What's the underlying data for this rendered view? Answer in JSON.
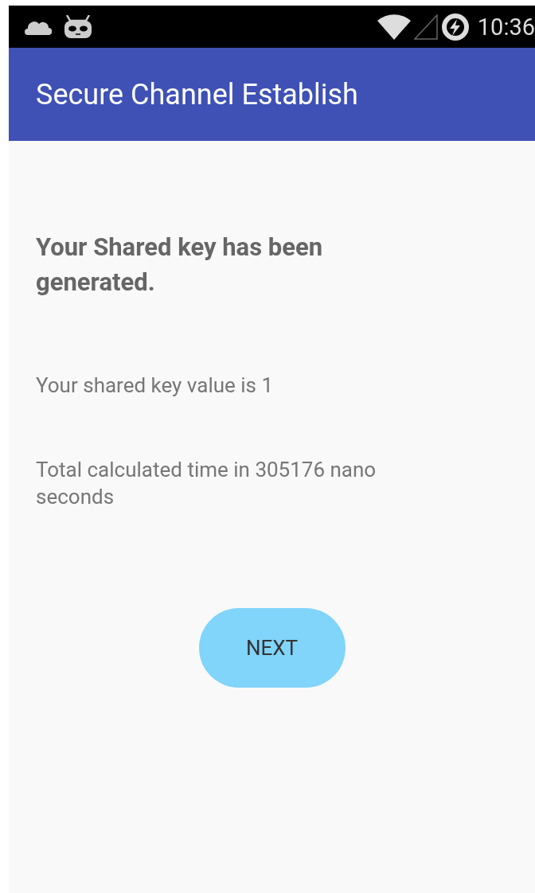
{
  "status_bar": {
    "time": "10:36"
  },
  "app_bar": {
    "title": "Secure Channel Establish"
  },
  "content": {
    "heading": "Your Shared key has been generated.",
    "lines": [
      "Your shared key value is 1",
      "Total calculated time in 305176 nano seconds"
    ],
    "button": "NEXT"
  }
}
